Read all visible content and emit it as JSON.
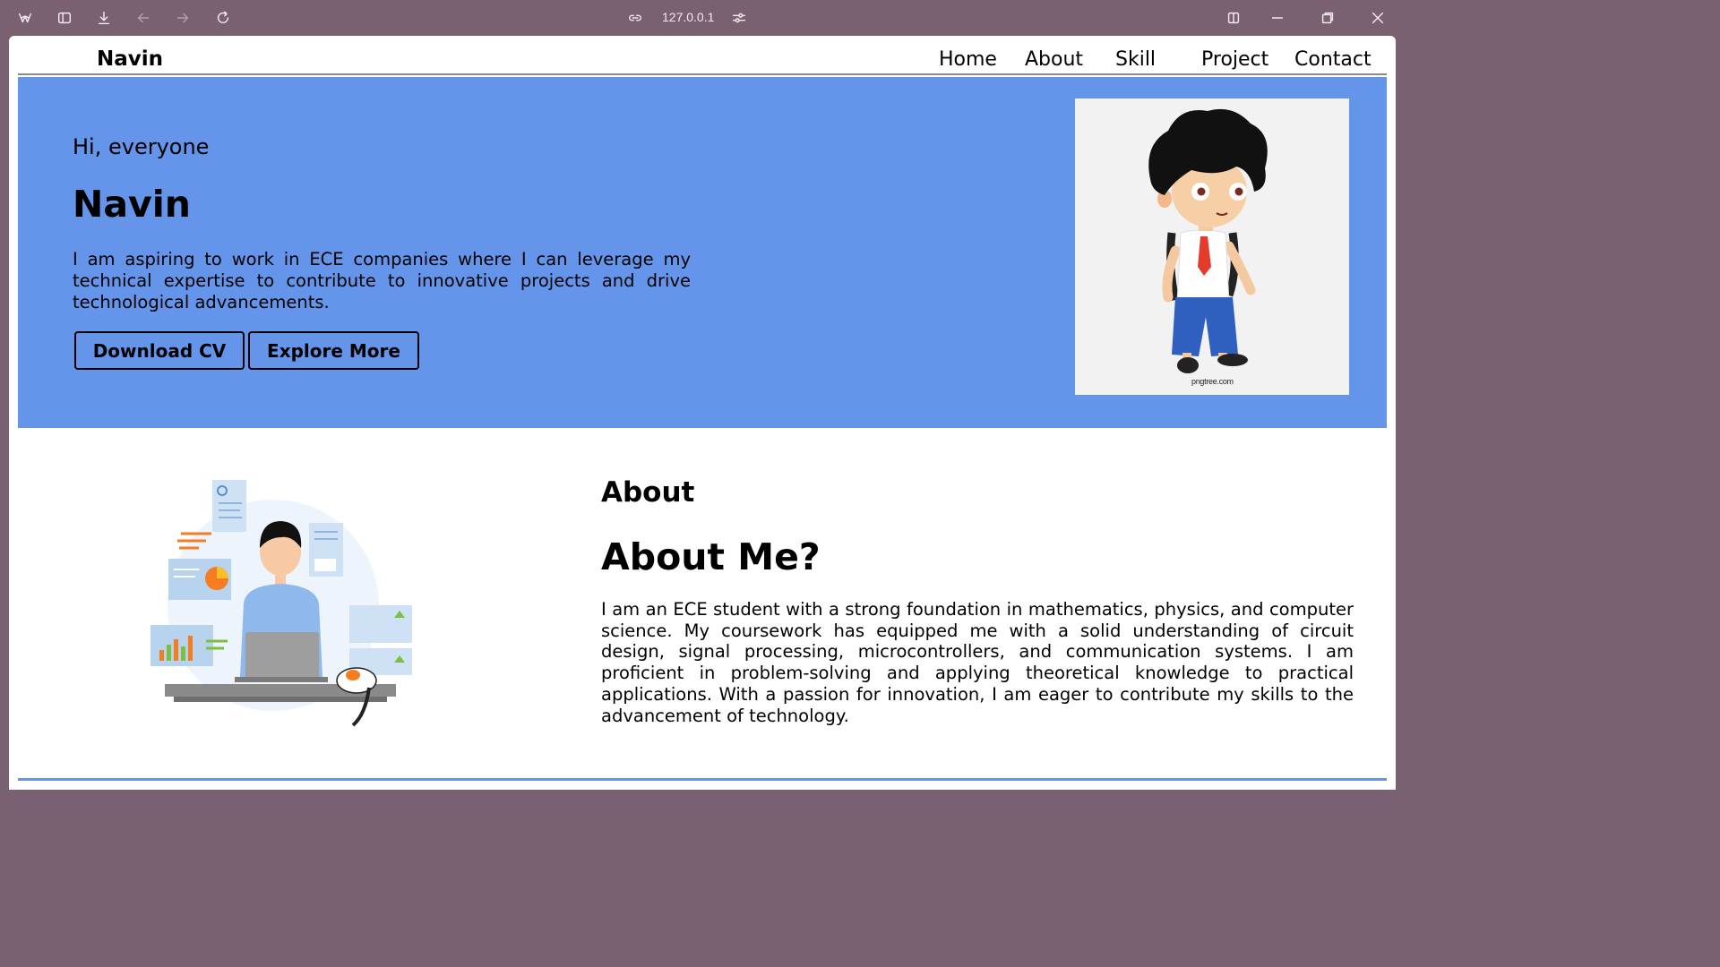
{
  "browser": {
    "url": "127.0.0.1",
    "icons": [
      "app-logo-icon",
      "sidebar-icon",
      "download-icon",
      "back-icon",
      "forward-icon",
      "reload-icon",
      "link-icon",
      "site-settings-icon",
      "split-view-icon",
      "minimize-icon",
      "restore-icon",
      "close-icon"
    ]
  },
  "navbar": {
    "brand": "Navin",
    "links": [
      {
        "label": "Home"
      },
      {
        "label": "About"
      },
      {
        "label": "Skill"
      },
      {
        "label": "Project"
      },
      {
        "label": "Contact"
      }
    ]
  },
  "hero": {
    "greeting": "Hi, everyone",
    "name": "Navin",
    "description": "I am aspiring to work in ECE companies where I can leverage my technical expertise to contribute to innovative projects and drive technological advancements.",
    "buttons": {
      "download": "Download CV",
      "explore": "Explore More"
    },
    "image_credit": "pngtree.com",
    "background_color": "#6495ea"
  },
  "about": {
    "label": "About",
    "title": "About Me?",
    "text": "I am an ECE student with a strong foundation in mathematics, physics, and computer science. My coursework has equipped me with a solid understanding of circuit design, signal processing, microcontrollers, and communication systems. I am proficient in problem-solving and applying theoretical knowledge to practical applications. With a passion for innovation, I am eager to contribute my skills to the advancement of technology."
  }
}
